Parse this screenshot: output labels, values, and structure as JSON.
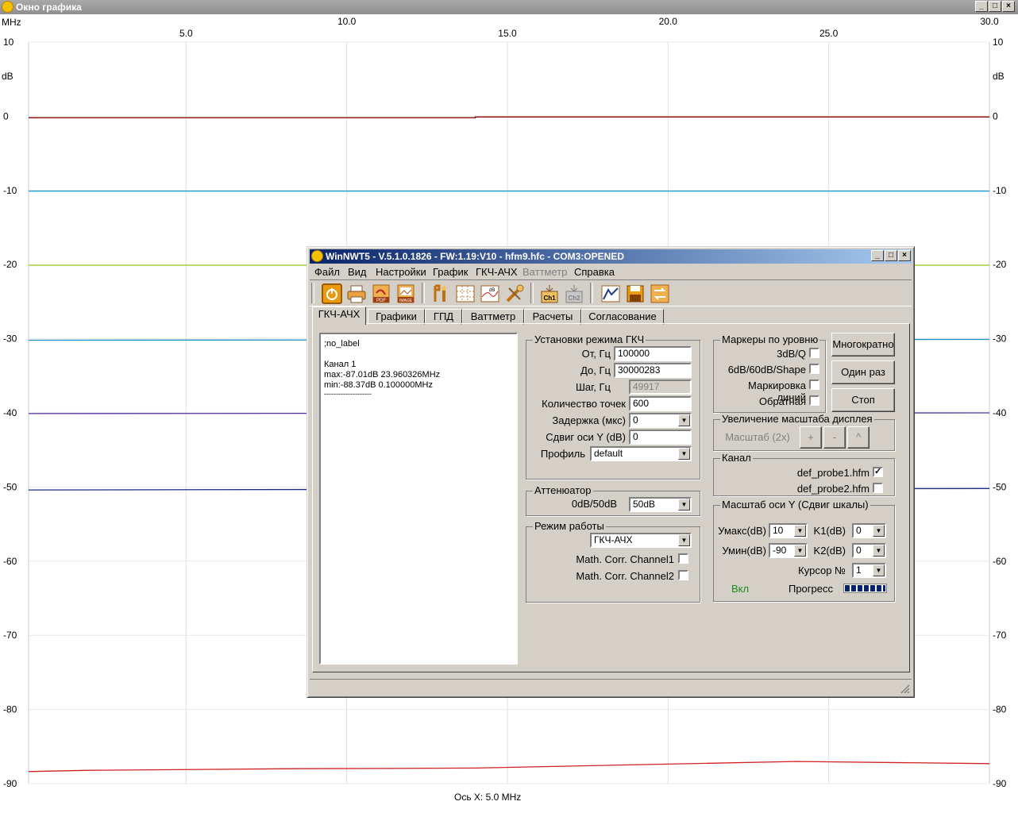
{
  "graph_window": {
    "title": "Окно графика",
    "x_unit": "MHz",
    "y_unit": "dB",
    "x_caption": "Ось X: 5.0 MHz"
  },
  "chart_data": {
    "type": "line",
    "xlim": [
      0.1,
      30.0
    ],
    "ylim": [
      -90,
      10
    ],
    "x_ticks": [
      5.0,
      10.0,
      15.0,
      20.0,
      25.0,
      30.0
    ],
    "x_tick_labels": [
      "5.0",
      "10.0",
      "15.0",
      "20.0",
      "25.0",
      "30.0"
    ],
    "y_ticks": [
      10,
      0,
      -10,
      -20,
      -30,
      -40,
      -50,
      -60,
      -70,
      -80,
      -90
    ],
    "y_tick_labels": [
      "10",
      "0",
      "-10",
      "-20",
      "-30",
      "-40",
      "-50",
      "-60",
      "-70",
      "-80",
      "-90"
    ],
    "grid": true,
    "series": [
      {
        "color": "#8b0000",
        "x": [
          0.1,
          14.0,
          14.0,
          30.0
        ],
        "values": [
          -0.2,
          -0.2,
          -0.1,
          -0.1
        ]
      },
      {
        "color": "#1fa0d0",
        "x": [
          0.1,
          30.0
        ],
        "values": [
          -10.1,
          -10.1
        ]
      },
      {
        "color": "#9ad020",
        "x": [
          0.1,
          30.0
        ],
        "values": [
          -20.1,
          -20.1
        ]
      },
      {
        "color": "#1f8fc8",
        "x": [
          0.1,
          30.0
        ],
        "values": [
          -30.2,
          -30.1
        ]
      },
      {
        "color": "#5030a0",
        "x": [
          0.1,
          30.0
        ],
        "values": [
          -40.1,
          -40.0
        ]
      },
      {
        "color": "#1a2a80",
        "x": [
          0.1,
          30.0
        ],
        "values": [
          -50.4,
          -50.2
        ]
      },
      {
        "color": "#d02020",
        "x": [
          0.1,
          2.0,
          8.0,
          14.0,
          23.96,
          30.0
        ],
        "values": [
          -88.37,
          -88.2,
          -88.0,
          -87.9,
          -87.01,
          -87.3
        ]
      }
    ]
  },
  "dialog": {
    "title": "WinNWT5 - V.5.1.0.1826 - FW:1.19:V10 - hfm9.hfc - COM3:OPENED",
    "menu": [
      "Файл",
      "Вид",
      "Настройки",
      "График",
      "ГКЧ-АЧХ",
      "Ваттметр",
      "Справка"
    ],
    "toolbar_icons": [
      "power-icon",
      "print-icon",
      "pdf-icon",
      "image-icon",
      "tools-icon",
      "grid-icon",
      "db-chart-icon",
      "wrench-icon",
      "ch1-icon",
      "ch2-icon",
      "curve-icon",
      "save-icon",
      "swap-icon"
    ],
    "toolbar_texts": {
      "pdf": "PDF",
      "image": "IMAGE",
      "db": "dB",
      "ch1": "Ch1",
      "ch2": "Ch2"
    },
    "tabs": [
      "ГКЧ-АЧХ",
      "Графики",
      "ГПД",
      "Ваттметр",
      "Расчеты",
      "Согласование"
    ],
    "memo": {
      "line1": ";no_label",
      "line2": "Канал 1",
      "line3": "max:-87.01dB 23.960326MHz",
      "line4": "min:-88.37dB 0.100000MHz",
      "line5": "--------------------"
    },
    "sweep": {
      "caption": "Установки режима ГКЧ",
      "from_label": "От, Гц",
      "from_value": "100000",
      "to_label": "До, Гц",
      "to_value": "30000283",
      "step_label": "Шаг, Гц",
      "step_value": "49917",
      "points_label": "Количество точек",
      "points_value": "600",
      "delay_label": "Задержка (мкс)",
      "delay_value": "0",
      "yshift_label": "Сдвиг оси Y (dB)",
      "yshift_value": "0",
      "profile_label": "Профиль",
      "profile_value": "default"
    },
    "attenuator": {
      "caption": "Аттенюатор",
      "label": "0dB/50dB",
      "value": "50dB"
    },
    "mode": {
      "caption": "Режим работы",
      "value": "ГКЧ-АЧХ",
      "corr1": "Math. Corr. Channel1",
      "corr2": "Math. Corr. Channel2"
    },
    "markers": {
      "caption": "Маркеры по уровню",
      "m1": "3dB/Q",
      "m2": "6dB/60dB/Shape",
      "m3": "Маркировка линий",
      "m4": "Обратная"
    },
    "buttons": {
      "multi": "Многократно",
      "once": "Один раз",
      "stop": "Стоп"
    },
    "zoom": {
      "caption": "Увеличение масштаба дисплея",
      "label": "Масштаб (2x)",
      "plus": "+",
      "minus": "-",
      "up": "^"
    },
    "channel": {
      "caption": "Канал",
      "probe1": "def_probe1.hfm",
      "probe1_checked": true,
      "probe2": "def_probe2.hfm",
      "probe2_checked": false
    },
    "yscale": {
      "caption": "Масштаб оси Y (Сдвиг шкалы)",
      "ymax_label": "Умакс(dB)",
      "ymax_value": "10",
      "ymin_label": "Умин(dB)",
      "ymin_value": "-90",
      "k1_label": "K1(dB)",
      "k1_value": "0",
      "k2_label": "K2(dB)",
      "k2_value": "0",
      "cursor_label": "Курсор №",
      "cursor_value": "1",
      "on_label": "Вкл",
      "progress_label": "Прогресс"
    },
    "colors": {
      "on_label": "#1a8a1a",
      "progress": "#0a246a"
    }
  }
}
